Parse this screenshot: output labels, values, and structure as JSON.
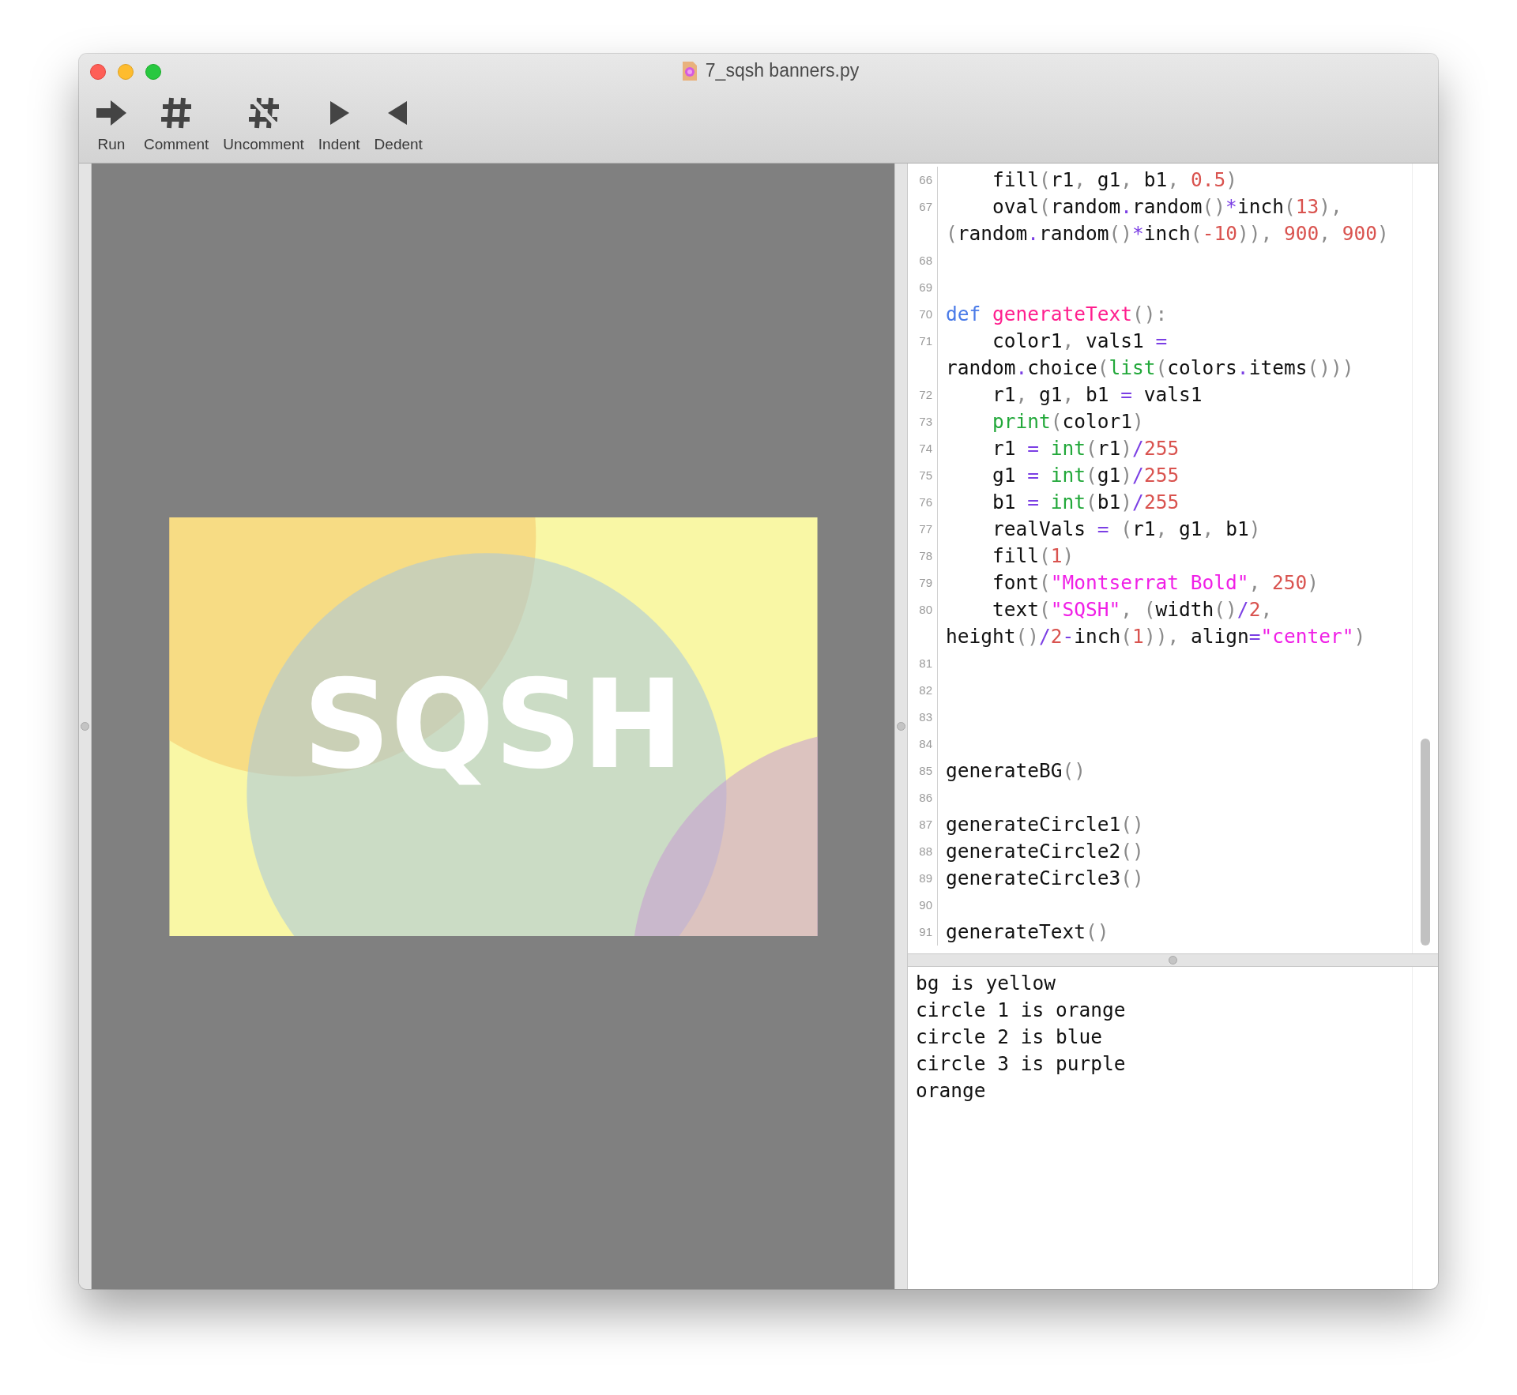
{
  "window": {
    "title": "7_sqsh banners.py"
  },
  "toolbar": [
    {
      "kind": "run",
      "label": "Run"
    },
    {
      "kind": "comment",
      "label": "Comment"
    },
    {
      "kind": "uncomment",
      "label": "Uncomment"
    },
    {
      "kind": "indent",
      "label": "Indent"
    },
    {
      "kind": "dedent",
      "label": "Dedent"
    }
  ],
  "canvas": {
    "banner_text": "SQSH"
  },
  "editor": {
    "lines": [
      {
        "number": "66",
        "tokens": [
          {
            "kind": "plain",
            "text": "    fill"
          },
          {
            "kind": "punct",
            "text": "("
          },
          {
            "kind": "plain",
            "text": "r1"
          },
          {
            "kind": "punct",
            "text": ", "
          },
          {
            "kind": "plain",
            "text": "g1"
          },
          {
            "kind": "punct",
            "text": ", "
          },
          {
            "kind": "plain",
            "text": "b1"
          },
          {
            "kind": "punct",
            "text": ", "
          },
          {
            "kind": "num",
            "text": "0.5"
          },
          {
            "kind": "punct",
            "text": ")"
          }
        ]
      },
      {
        "number": "67",
        "tokens": [
          {
            "kind": "plain",
            "text": "    oval"
          },
          {
            "kind": "punct",
            "text": "("
          },
          {
            "kind": "plain",
            "text": "random"
          },
          {
            "kind": "op",
            "text": "."
          },
          {
            "kind": "plain",
            "text": "random"
          },
          {
            "kind": "punct",
            "text": "()"
          },
          {
            "kind": "op",
            "text": "*"
          },
          {
            "kind": "plain",
            "text": "inch"
          },
          {
            "kind": "punct",
            "text": "("
          },
          {
            "kind": "num",
            "text": "13"
          },
          {
            "kind": "punct",
            "text": "), ("
          },
          {
            "kind": "plain",
            "text": "random"
          },
          {
            "kind": "op",
            "text": "."
          },
          {
            "kind": "plain",
            "text": "random"
          },
          {
            "kind": "punct",
            "text": "()"
          },
          {
            "kind": "op",
            "text": "*"
          },
          {
            "kind": "plain",
            "text": "inch"
          },
          {
            "kind": "punct",
            "text": "("
          },
          {
            "kind": "num",
            "text": "-10"
          },
          {
            "kind": "punct",
            "text": ")), "
          },
          {
            "kind": "num",
            "text": "900"
          },
          {
            "kind": "punct",
            "text": ", "
          },
          {
            "kind": "num",
            "text": "900"
          },
          {
            "kind": "punct",
            "text": ")"
          }
        ]
      },
      {
        "number": "68"
      },
      {
        "number": "69"
      },
      {
        "number": "70",
        "tokens": [
          {
            "kind": "keyword",
            "text": "def "
          },
          {
            "kind": "function",
            "text": "generateText"
          },
          {
            "kind": "punct",
            "text": "():"
          }
        ]
      },
      {
        "number": "71",
        "tokens": [
          {
            "kind": "plain",
            "text": "    color1"
          },
          {
            "kind": "punct",
            "text": ", "
          },
          {
            "kind": "plain",
            "text": "vals1 "
          },
          {
            "kind": "op",
            "text": "="
          },
          {
            "kind": "plain",
            "text": " random"
          },
          {
            "kind": "op",
            "text": "."
          },
          {
            "kind": "plain",
            "text": "choice"
          },
          {
            "kind": "punct",
            "text": "("
          },
          {
            "kind": "builtin",
            "text": "list"
          },
          {
            "kind": "punct",
            "text": "("
          },
          {
            "kind": "plain",
            "text": "colors"
          },
          {
            "kind": "op",
            "text": "."
          },
          {
            "kind": "plain",
            "text": "items"
          },
          {
            "kind": "punct",
            "text": "()))"
          }
        ]
      },
      {
        "number": "72",
        "tokens": [
          {
            "kind": "plain",
            "text": "    r1"
          },
          {
            "kind": "punct",
            "text": ", "
          },
          {
            "kind": "plain",
            "text": "g1"
          },
          {
            "kind": "punct",
            "text": ", "
          },
          {
            "kind": "plain",
            "text": "b1 "
          },
          {
            "kind": "op",
            "text": "="
          },
          {
            "kind": "plain",
            "text": " vals1"
          }
        ]
      },
      {
        "number": "73",
        "tokens": [
          {
            "kind": "builtin",
            "text": "    print"
          },
          {
            "kind": "punct",
            "text": "("
          },
          {
            "kind": "plain",
            "text": "color1"
          },
          {
            "kind": "punct",
            "text": ")"
          }
        ]
      },
      {
        "number": "74",
        "tokens": [
          {
            "kind": "plain",
            "text": "    r1 "
          },
          {
            "kind": "op",
            "text": "= "
          },
          {
            "kind": "builtin",
            "text": "int"
          },
          {
            "kind": "punct",
            "text": "("
          },
          {
            "kind": "plain",
            "text": "r1"
          },
          {
            "kind": "punct",
            "text": ")"
          },
          {
            "kind": "op",
            "text": "/"
          },
          {
            "kind": "num",
            "text": "255"
          }
        ]
      },
      {
        "number": "75",
        "tokens": [
          {
            "kind": "plain",
            "text": "    g1 "
          },
          {
            "kind": "op",
            "text": "= "
          },
          {
            "kind": "builtin",
            "text": "int"
          },
          {
            "kind": "punct",
            "text": "("
          },
          {
            "kind": "plain",
            "text": "g1"
          },
          {
            "kind": "punct",
            "text": ")"
          },
          {
            "kind": "op",
            "text": "/"
          },
          {
            "kind": "num",
            "text": "255"
          }
        ]
      },
      {
        "number": "76",
        "tokens": [
          {
            "kind": "plain",
            "text": "    b1 "
          },
          {
            "kind": "op",
            "text": "= "
          },
          {
            "kind": "builtin",
            "text": "int"
          },
          {
            "kind": "punct",
            "text": "("
          },
          {
            "kind": "plain",
            "text": "b1"
          },
          {
            "kind": "punct",
            "text": ")"
          },
          {
            "kind": "op",
            "text": "/"
          },
          {
            "kind": "num",
            "text": "255"
          }
        ]
      },
      {
        "number": "77",
        "tokens": [
          {
            "kind": "plain",
            "text": "    realVals "
          },
          {
            "kind": "op",
            "text": "="
          },
          {
            "kind": "punct",
            "text": " ("
          },
          {
            "kind": "plain",
            "text": "r1"
          },
          {
            "kind": "punct",
            "text": ", "
          },
          {
            "kind": "plain",
            "text": "g1"
          },
          {
            "kind": "punct",
            "text": ", "
          },
          {
            "kind": "plain",
            "text": "b1"
          },
          {
            "kind": "punct",
            "text": ")"
          }
        ]
      },
      {
        "number": "78",
        "tokens": [
          {
            "kind": "plain",
            "text": "    fill"
          },
          {
            "kind": "punct",
            "text": "("
          },
          {
            "kind": "num",
            "text": "1"
          },
          {
            "kind": "punct",
            "text": ")"
          }
        ]
      },
      {
        "number": "79",
        "tokens": [
          {
            "kind": "plain",
            "text": "    font"
          },
          {
            "kind": "punct",
            "text": "("
          },
          {
            "kind": "string",
            "text": "\"Montserrat Bold\""
          },
          {
            "kind": "punct",
            "text": ", "
          },
          {
            "kind": "num",
            "text": "250"
          },
          {
            "kind": "punct",
            "text": ")"
          }
        ]
      },
      {
        "number": "80",
        "tokens": [
          {
            "kind": "plain",
            "text": "    text"
          },
          {
            "kind": "punct",
            "text": "("
          },
          {
            "kind": "string",
            "text": "\"SQSH\""
          },
          {
            "kind": "punct",
            "text": ", ("
          },
          {
            "kind": "plain",
            "text": "width"
          },
          {
            "kind": "punct",
            "text": "()"
          },
          {
            "kind": "op",
            "text": "/"
          },
          {
            "kind": "num",
            "text": "2"
          },
          {
            "kind": "punct",
            "text": ", "
          },
          {
            "kind": "plain",
            "text": "height"
          },
          {
            "kind": "punct",
            "text": "()"
          },
          {
            "kind": "op",
            "text": "/"
          },
          {
            "kind": "num",
            "text": "2"
          },
          {
            "kind": "op",
            "text": "-"
          },
          {
            "kind": "plain",
            "text": "inch"
          },
          {
            "kind": "punct",
            "text": "("
          },
          {
            "kind": "num",
            "text": "1"
          },
          {
            "kind": "punct",
            "text": ")), "
          },
          {
            "kind": "plain",
            "text": "align"
          },
          {
            "kind": "op",
            "text": "="
          },
          {
            "kind": "string",
            "text": "\"center\""
          },
          {
            "kind": "punct",
            "text": ")"
          }
        ]
      },
      {
        "number": "81"
      },
      {
        "number": "82"
      },
      {
        "number": "83"
      },
      {
        "number": "84"
      },
      {
        "number": "85",
        "tokens": [
          {
            "kind": "plain",
            "text": "generateBG"
          },
          {
            "kind": "punct",
            "text": "()"
          }
        ]
      },
      {
        "number": "86"
      },
      {
        "number": "87",
        "tokens": [
          {
            "kind": "plain",
            "text": "generateCircle1"
          },
          {
            "kind": "punct",
            "text": "()"
          }
        ]
      },
      {
        "number": "88",
        "tokens": [
          {
            "kind": "plain",
            "text": "generateCircle2"
          },
          {
            "kind": "punct",
            "text": "()"
          }
        ]
      },
      {
        "number": "89",
        "tokens": [
          {
            "kind": "plain",
            "text": "generateCircle3"
          },
          {
            "kind": "punct",
            "text": "()"
          }
        ]
      },
      {
        "number": "90"
      },
      {
        "number": "91",
        "tokens": [
          {
            "kind": "plain",
            "text": "generateText"
          },
          {
            "kind": "punct",
            "text": "()"
          }
        ]
      }
    ]
  },
  "console": {
    "lines": [
      "bg is yellow",
      "circle 1 is orange",
      "circle 2 is blue",
      "circle 3 is purple",
      "orange"
    ]
  }
}
